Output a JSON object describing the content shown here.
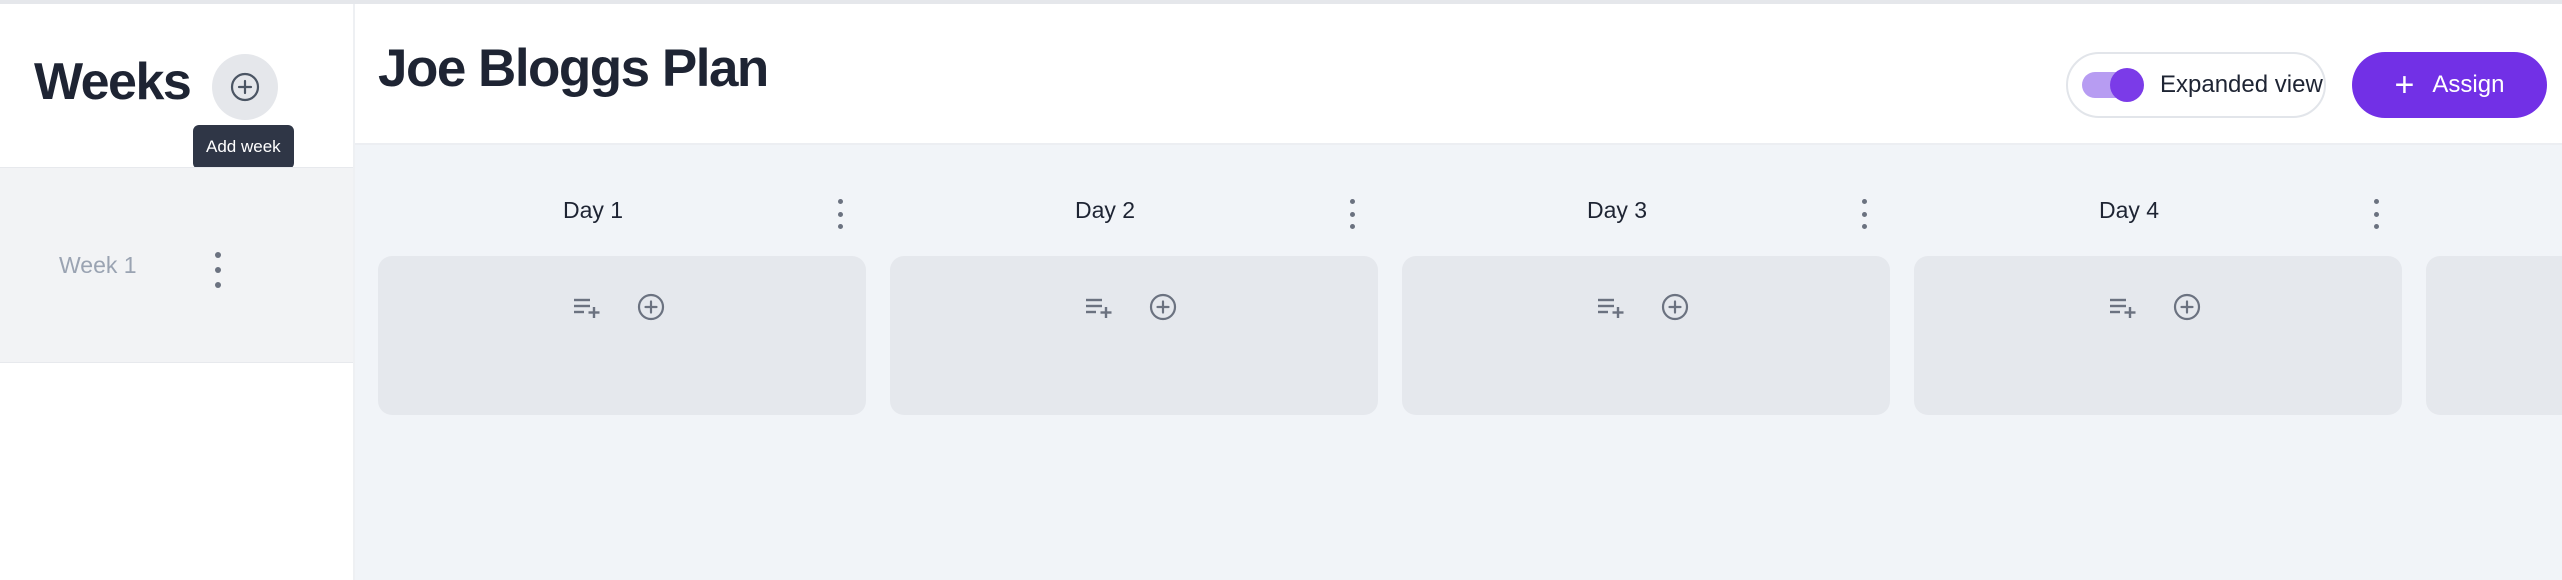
{
  "sidebar": {
    "title": "Weeks",
    "add_week_tooltip": "Add week",
    "weeks": [
      {
        "label": "Week 1"
      }
    ]
  },
  "header": {
    "plan_title": "Joe Bloggs Plan",
    "expanded_view_label": "Expanded view",
    "expanded_view_on": true,
    "assign_label": "Assign"
  },
  "days": [
    {
      "label": "Day 1"
    },
    {
      "label": "Day 2"
    },
    {
      "label": "Day 3"
    },
    {
      "label": "Day 4"
    }
  ],
  "colors": {
    "accent": "#7230e6",
    "toggle_track": "#b79cf2",
    "board_bg": "#f1f4f8",
    "card_bg": "#e5e8ed",
    "tooltip_bg": "#2f3646"
  },
  "icons": {
    "add_week": "plus-circle-icon",
    "add_list": "playlist-add-icon",
    "add_item": "plus-circle-icon",
    "menu": "kebab-menu-icon",
    "assign": "plus-icon"
  }
}
